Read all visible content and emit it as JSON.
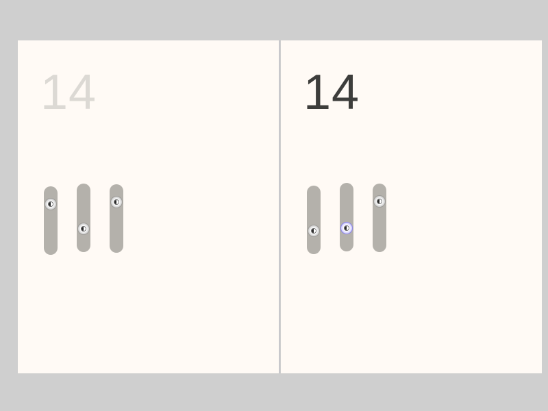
{
  "panels": [
    {
      "id": "left",
      "value_text": "14",
      "sliders": [
        {
          "name": "slider-1",
          "value": 0.8,
          "active": false
        },
        {
          "name": "slider-2",
          "value": 0.3,
          "active": false
        },
        {
          "name": "slider-3",
          "value": 0.8,
          "active": false
        }
      ]
    },
    {
      "id": "right",
      "value_text": "14",
      "sliders": [
        {
          "name": "slider-1",
          "value": 0.3,
          "active": false
        },
        {
          "name": "slider-2",
          "value": 0.3,
          "active": true
        },
        {
          "name": "slider-3",
          "value": 0.8,
          "active": false
        }
      ]
    }
  ],
  "colors": {
    "background": "#cfcfcf",
    "panel": "#fffaf5",
    "track": "#b4b1ab",
    "value_left": "#dcd9d4",
    "value_right": "#3d3d3b",
    "thumb_active": "#b9b4ff"
  },
  "icons": {
    "thumb": "slider-thumb-icon"
  }
}
